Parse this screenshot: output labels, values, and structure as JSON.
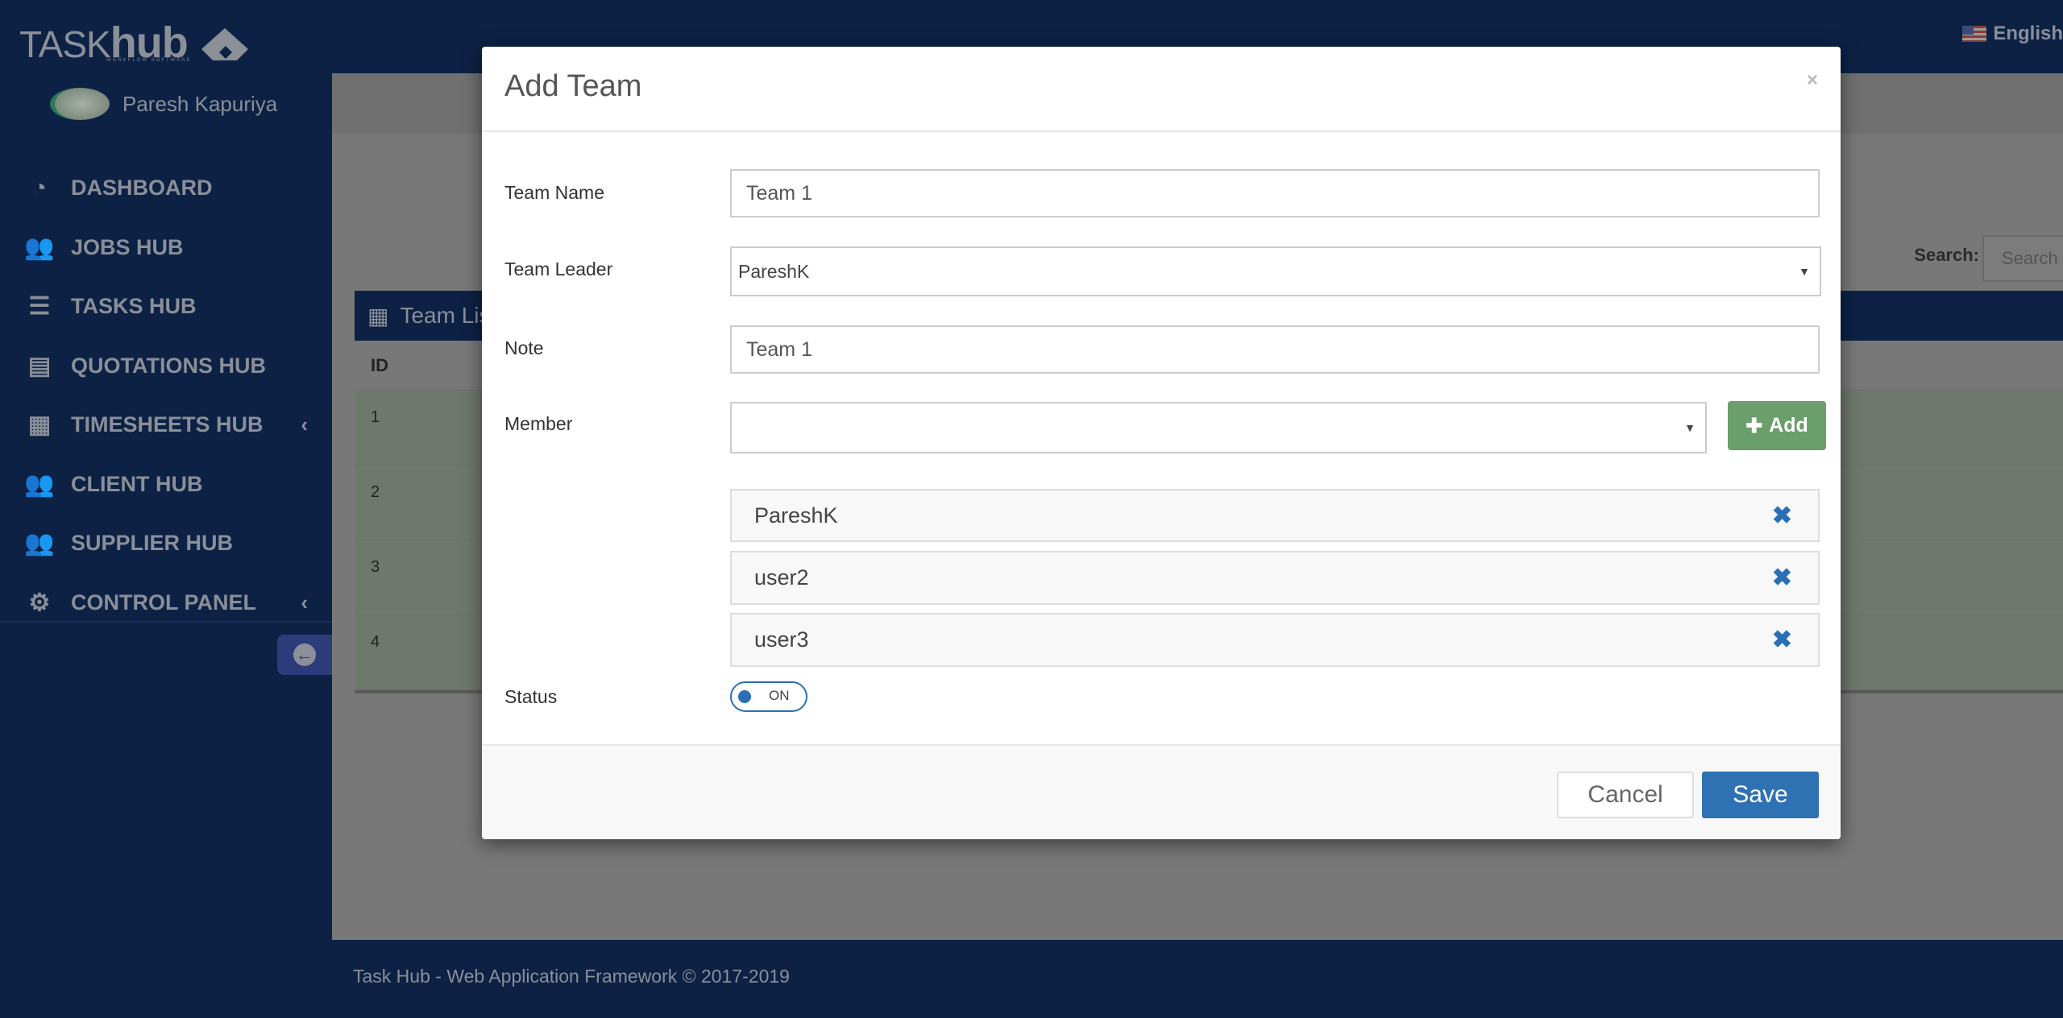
{
  "app": {
    "logo_text_light": "TASK",
    "logo_text_bold": "hub",
    "logo_subtitle": "WORKFLOW SOFTWARE",
    "language": "English",
    "language_icon": "us-flag-icon"
  },
  "sidebar": {
    "user_name": "Paresh Kapuriya",
    "items": [
      {
        "label": "DASHBOARD",
        "icon": "dashboard-icon",
        "glyph": "◔",
        "has_submenu": false
      },
      {
        "label": "JOBS HUB",
        "icon": "users-icon",
        "glyph": "👥",
        "has_submenu": false
      },
      {
        "label": "TASKS HUB",
        "icon": "server-icon",
        "glyph": "☰",
        "has_submenu": false
      },
      {
        "label": "QUOTATIONS HUB",
        "icon": "list-icon",
        "glyph": "▤",
        "has_submenu": false
      },
      {
        "label": "TIMESHEETS HUB",
        "icon": "calendar-icon",
        "glyph": "▦",
        "has_submenu": true
      },
      {
        "label": "CLIENT HUB",
        "icon": "users-icon",
        "glyph": "👥",
        "has_submenu": false
      },
      {
        "label": "SUPPLIER HUB",
        "icon": "users-icon",
        "glyph": "👥",
        "has_submenu": false
      },
      {
        "label": "CONTROL PANEL",
        "icon": "gears-icon",
        "glyph": "⚙",
        "has_submenu": true
      }
    ],
    "submenu_chevron": "‹",
    "collapse_glyph": "←"
  },
  "main": {
    "search_label": "Search:",
    "search_placeholder": "Search",
    "panel_title": "Team List",
    "table": {
      "columns": [
        "ID"
      ],
      "rows": [
        [
          "1"
        ],
        [
          "2"
        ],
        [
          "3"
        ],
        [
          "4"
        ]
      ]
    }
  },
  "footer": {
    "text": "Task Hub - Web Application Framework © 2017-2019"
  },
  "modal": {
    "title": "Add Team",
    "close_glyph": "×",
    "fields": {
      "team_name": {
        "label": "Team Name",
        "value": "Team 1"
      },
      "team_leader": {
        "label": "Team Leader",
        "value": "PareshK"
      },
      "note": {
        "label": "Note",
        "value": "Team 1"
      },
      "member": {
        "label": "Member",
        "value": ""
      },
      "status": {
        "label": "Status",
        "value": "ON"
      }
    },
    "add_button": "Add",
    "add_glyph": "✚",
    "members": [
      "PareshK",
      "user2",
      "user3"
    ],
    "remove_glyph": "✖",
    "cancel_button": "Cancel",
    "save_button": "Save"
  }
}
